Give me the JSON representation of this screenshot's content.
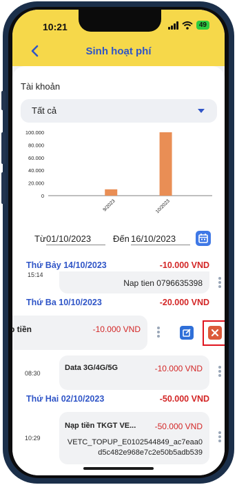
{
  "status_bar": {
    "time": "10:21",
    "battery": "49"
  },
  "header": {
    "title": "Sinh hoạt phí"
  },
  "account": {
    "label": "Tài khoản",
    "selected": "Tất cả"
  },
  "chart_data": {
    "type": "bar",
    "categories": [
      "9/2023",
      "10/2023"
    ],
    "values": [
      10000,
      100000
    ],
    "ylim": [
      0,
      100000
    ],
    "y_ticks": [
      "0",
      "20.000",
      "40.000",
      "60.000",
      "80.000",
      "100.000"
    ],
    "bar_color": "#e98e55",
    "grid": false
  },
  "date_filter": {
    "from_label": "Từ",
    "from_value": "01/10/2023",
    "to_label": "Đến",
    "to_value": "16/10/2023"
  },
  "groups": [
    {
      "day": "Thứ Bảy 14/10/2023",
      "total": "-10.000 VND",
      "items": [
        {
          "time": "15:14",
          "note": "Nap tien 0796635398"
        }
      ]
    },
    {
      "day": "Thứ Ba 10/10/2023",
      "total": "-20.000 VND",
      "items": [
        {
          "title": "p tiền",
          "amount": "-10.000 VND"
        },
        {
          "time": "08:30",
          "title": "Data 3G/4G/5G",
          "amount": "-10.000 VND"
        }
      ]
    },
    {
      "day": "Thứ Hai 02/10/2023",
      "total": "-50.000 VND",
      "items": [
        {
          "time": "10:29",
          "title": "Nạp tiền TKGT VE...",
          "amount": "-50.000 VND",
          "note_line1": "VETC_TOPUP_E0102544849_ac7eaa0",
          "note_line2": "d5c482e968e7c2e50b5adb539"
        }
      ]
    }
  ],
  "colors": {
    "accent": "#2f55c7",
    "header_bg": "#f6d84a",
    "negative": "#d32626"
  }
}
